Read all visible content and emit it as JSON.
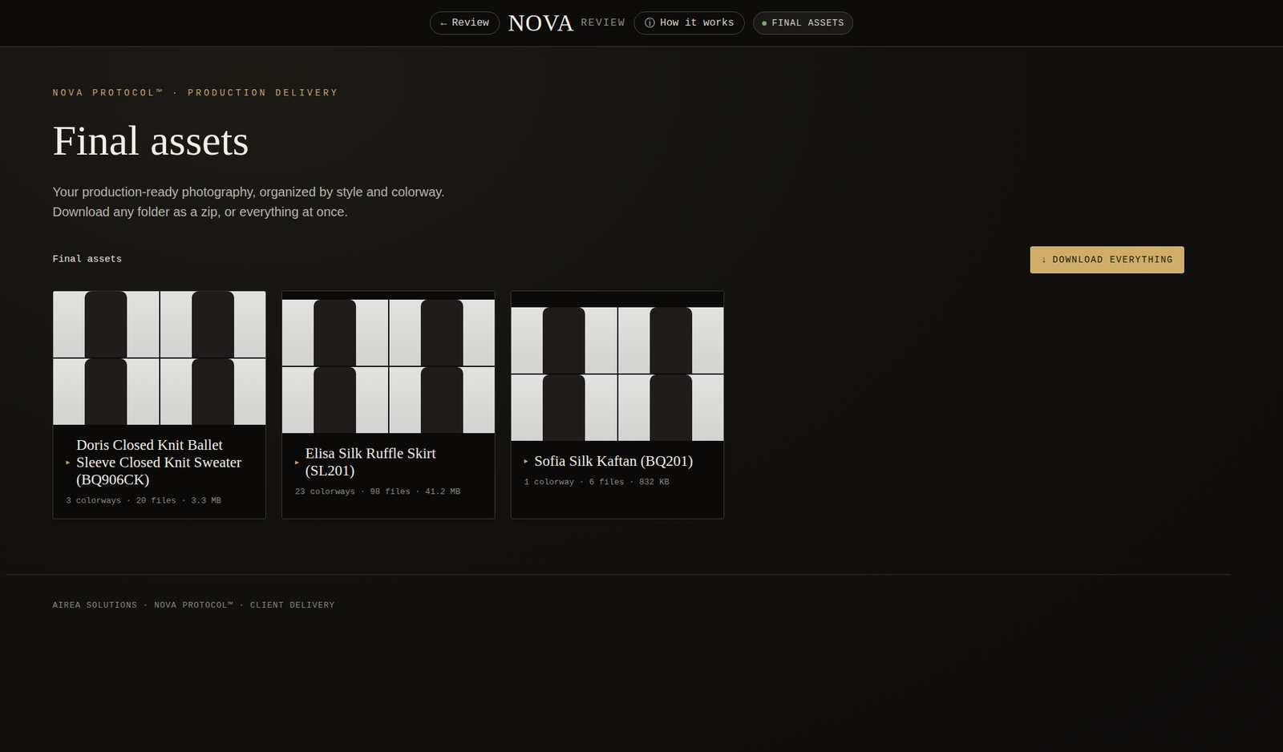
{
  "nav": {
    "items": [
      {
        "label": "Review",
        "icon": "←",
        "selected": false
      },
      {
        "label": "How it works",
        "icon": "ⓘ",
        "selected": false
      },
      {
        "label": "FINAL ASSETS",
        "icon": "",
        "selected": true
      }
    ],
    "logo": "NOVA",
    "logo_sub": "REVIEW"
  },
  "eyebrow": "NOVA PROTOCOL™ · PRODUCTION DELIVERY",
  "title": "Final assets",
  "description": [
    "Your production-ready photography, organized by style and colorway.",
    "Download any folder as a zip, or everything at once."
  ],
  "section": {
    "label": "Final assets",
    "button": {
      "icon": "↓",
      "label": "DOWNLOAD EVERYTHING"
    }
  },
  "cards": [
    {
      "marker": "▸",
      "title": "Doris Closed Knit Ballet Sleeve Closed Knit Sweater (BQ906CK)",
      "meta": "3 colorways · 20 files · 3.3 MB",
      "expanded": false
    },
    {
      "marker": "▸",
      "title": "Elisa Silk Ruffle Skirt (SL201)",
      "meta": "23 colorways · 98 files · 41.2 MB",
      "expanded": false
    },
    {
      "marker": "▸",
      "title": "Sofia Silk Kaftan (BQ201)",
      "meta": "1 colorway · 6 files · 832 KB",
      "expanded": false
    }
  ],
  "footer": "AIREA SOLUTIONS · NOVA PROTOCOL™ · CLIENT DELIVERY"
}
